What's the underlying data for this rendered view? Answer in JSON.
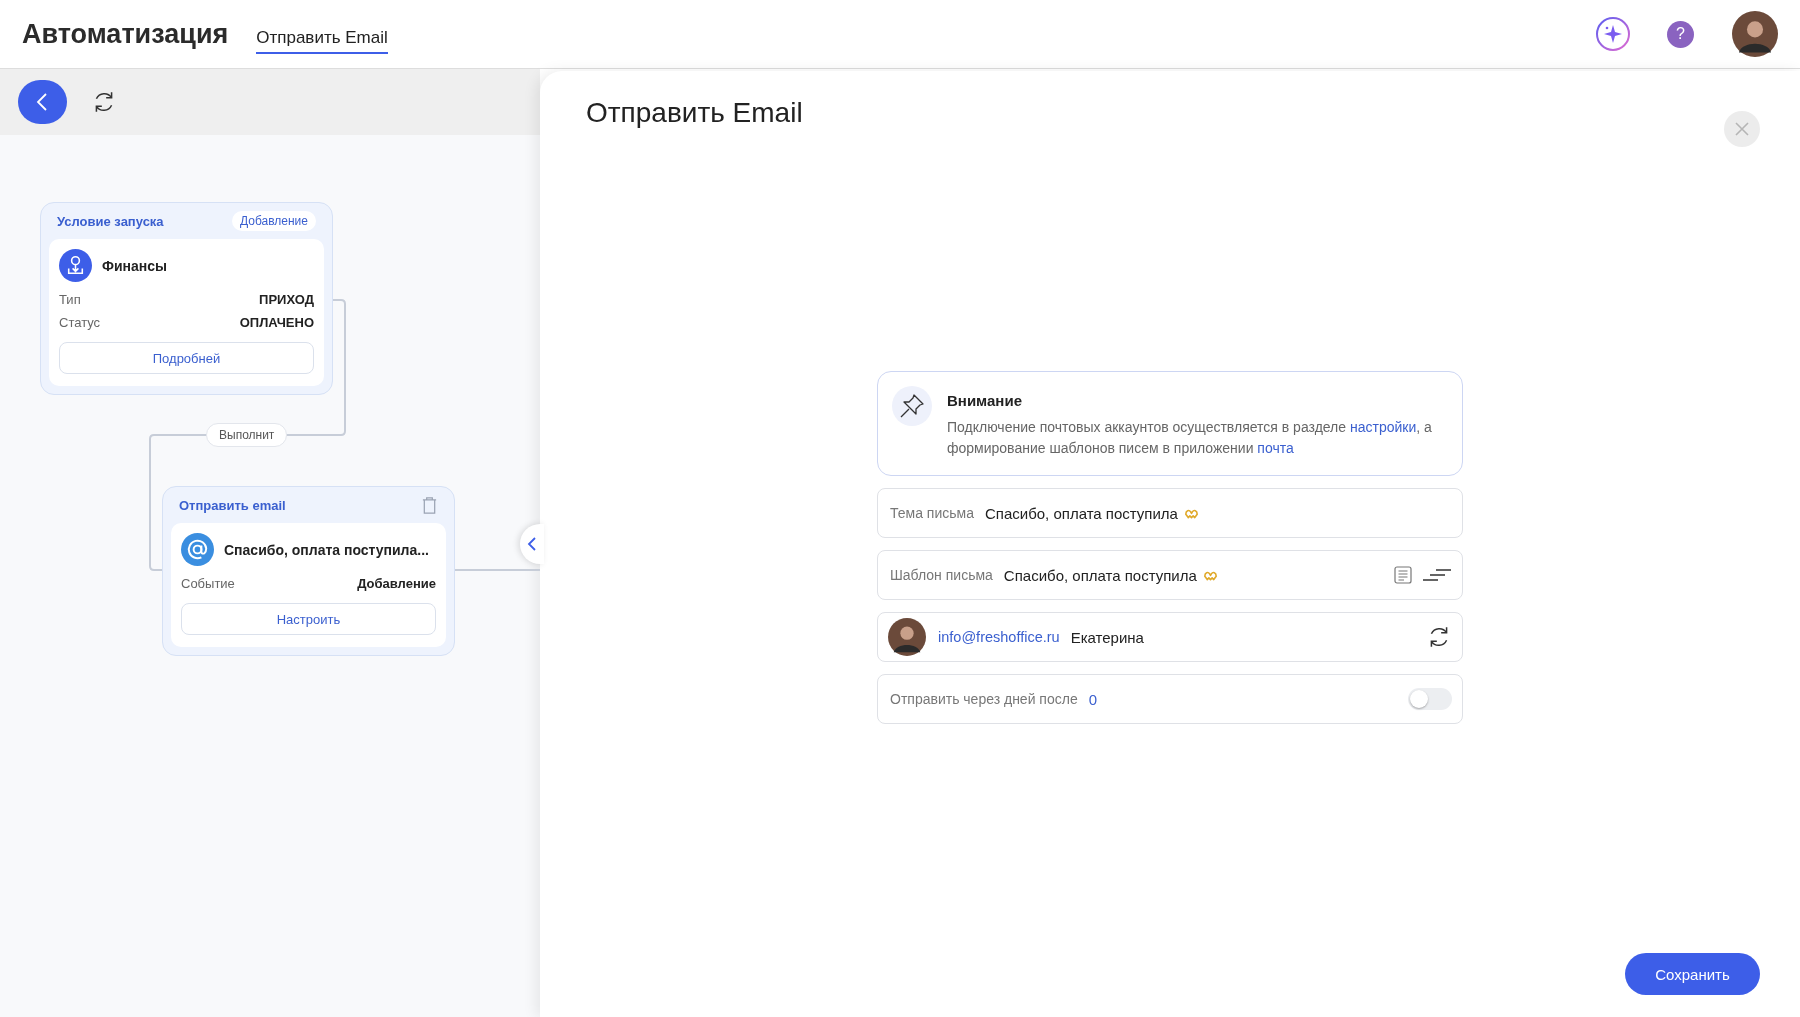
{
  "header": {
    "title": "Автоматизация",
    "help": "?",
    "tabs": [
      {
        "label": "Отправить Email",
        "selected": true
      }
    ]
  },
  "flow": {
    "nodes": [
      {
        "kind": "trigger",
        "header": "Условие запуска",
        "badge": "Добавление",
        "name": "Финансы",
        "rows": [
          {
            "label": "Тип",
            "value": "ПРИХОД"
          },
          {
            "label": "Статус",
            "value": "ОПЛАЧЕНО"
          }
        ],
        "button": "Подробней"
      },
      {
        "kind": "action",
        "header": "Отправить email",
        "name": "Спасибо, оплата поступила...",
        "rows": [
          {
            "label": "Событие",
            "value": "Добавление"
          }
        ],
        "button": "Настроить"
      }
    ],
    "connector_label": "Выполнит"
  },
  "panel": {
    "title": "Отправить Email",
    "notice": {
      "title": "Внимание",
      "text_1": "Подключение почтовых аккаунтов осуществляется в разделе ",
      "link_1": "настройки",
      "text_2": ", а формирование шаблонов писем в приложении ",
      "link_2": "почта"
    },
    "fields": [
      {
        "kind": "subject",
        "label": "Тема письма",
        "value": "Спасибо, оплата поступила"
      },
      {
        "kind": "template",
        "label": "Шаблон письма",
        "value": "Спасибо, оплата поступила"
      },
      {
        "kind": "sender",
        "email": "info@freshoffice.ru",
        "name": "Екатерина"
      },
      {
        "kind": "toggle",
        "label": "Отправить через дней после",
        "value": "0",
        "on": false
      }
    ],
    "save_button": "Сохранить"
  }
}
